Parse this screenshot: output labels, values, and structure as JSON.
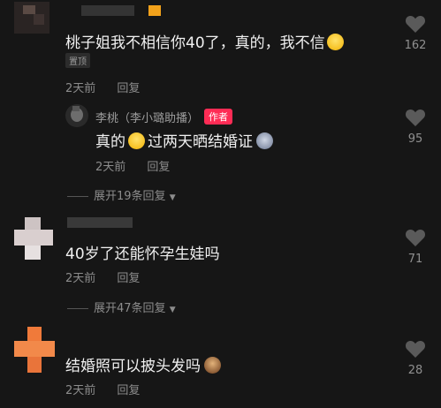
{
  "comments": [
    {
      "text": "桃子姐我不相信你40了，真的，我不信",
      "pinned_label": "置顶",
      "time": "2天前",
      "reply": "回复",
      "likes": "162",
      "emoji": "laugh-cry-emoji",
      "replies": [
        {
          "username": "李桃（李小璐助播）",
          "badge": "作者",
          "text_before": "真的",
          "text_middle": "过两天晒结婚证",
          "time": "2天前",
          "reply": "回复",
          "likes": "95"
        }
      ],
      "expand_label": "展开19条回复"
    },
    {
      "text": "40岁了还能怀孕生娃吗",
      "time": "2天前",
      "reply": "回复",
      "likes": "71",
      "expand_label": "展开47条回复"
    },
    {
      "text": "结婚照可以披头发吗",
      "time": "2天前",
      "reply": "回复",
      "likes": "28"
    }
  ],
  "colors": {
    "background": "#161616",
    "author_badge": "#fe2c55",
    "muted_text": "#8c8c8c"
  }
}
